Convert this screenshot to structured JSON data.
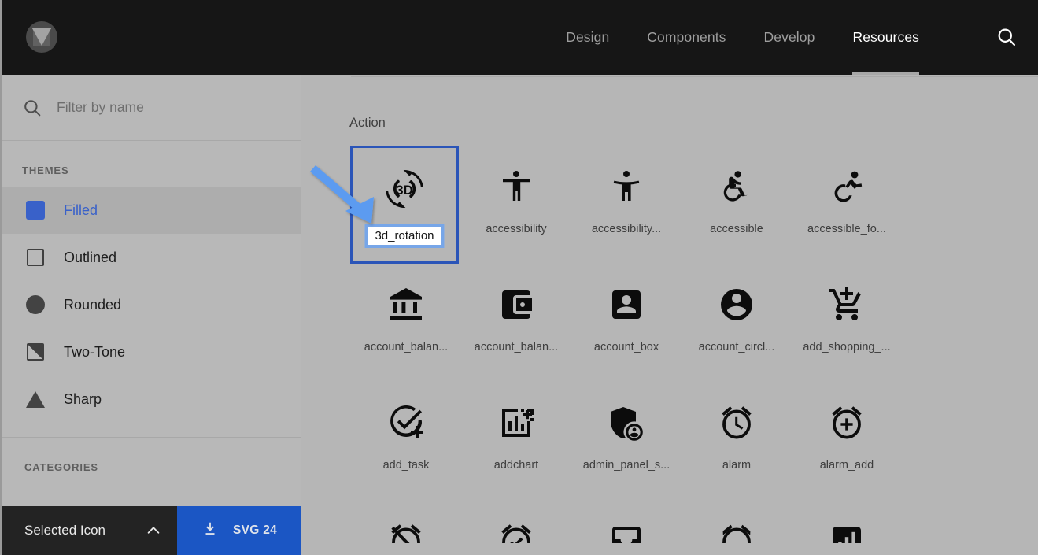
{
  "header": {
    "logo_name": "material-design-logo",
    "nav": [
      {
        "label": "Design",
        "active": false
      },
      {
        "label": "Components",
        "active": false
      },
      {
        "label": "Develop",
        "active": false
      },
      {
        "label": "Resources",
        "active": true
      }
    ],
    "search_icon": "search-icon"
  },
  "sidebar": {
    "filter": {
      "icon": "search-icon",
      "value": "",
      "placeholder": "Filter by name"
    },
    "themes_heading": "THEMES",
    "themes": [
      {
        "label": "Filled",
        "swatch": "filled-square-swatch",
        "selected": true
      },
      {
        "label": "Outlined",
        "swatch": "outlined-square-swatch",
        "selected": false
      },
      {
        "label": "Rounded",
        "swatch": "rounded-circle-swatch",
        "selected": false
      },
      {
        "label": "Two-Tone",
        "swatch": "two-tone-swatch",
        "selected": false
      },
      {
        "label": "Sharp",
        "swatch": "sharp-triangle-swatch",
        "selected": false
      }
    ],
    "categories_heading": "CATEGORIES"
  },
  "bottombar": {
    "selected_icon_label": "Selected Icon",
    "chevron_icon": "chevron-up-icon",
    "download_icon": "download-icon",
    "download_label": "SVG 24"
  },
  "content": {
    "group_title": "Action",
    "selected_icon_tooltip": "3d_rotation",
    "icons": [
      {
        "name": "3d_rotation",
        "glyph": "3d-rotation-icon",
        "selected": true
      },
      {
        "name": "accessibility",
        "glyph": "accessibility-icon",
        "selected": false
      },
      {
        "name": "accessibility...",
        "glyph": "accessibility-new-icon",
        "selected": false
      },
      {
        "name": "accessible",
        "glyph": "accessible-icon",
        "selected": false
      },
      {
        "name": "accessible_fo...",
        "glyph": "accessible-forward-icon",
        "selected": false
      },
      {
        "name": "account_balan...",
        "glyph": "account-balance-icon",
        "selected": false
      },
      {
        "name": "account_balan...",
        "glyph": "account-balance-wallet-icon",
        "selected": false
      },
      {
        "name": "account_box",
        "glyph": "account-box-icon",
        "selected": false
      },
      {
        "name": "account_circl...",
        "glyph": "account-circle-icon",
        "selected": false
      },
      {
        "name": "add_shopping_...",
        "glyph": "add-shopping-cart-icon",
        "selected": false
      },
      {
        "name": "add_task",
        "glyph": "add-task-icon",
        "selected": false
      },
      {
        "name": "addchart",
        "glyph": "addchart-icon",
        "selected": false
      },
      {
        "name": "admin_panel_s...",
        "glyph": "admin-panel-settings-icon",
        "selected": false
      },
      {
        "name": "alarm",
        "glyph": "alarm-icon",
        "selected": false
      },
      {
        "name": "alarm_add",
        "glyph": "alarm-add-icon",
        "selected": false
      }
    ],
    "partial_row_icons": [
      {
        "glyph": "alarm-off-icon"
      },
      {
        "glyph": "alarm-on-icon"
      },
      {
        "glyph": "all-inbox-icon"
      },
      {
        "glyph": "timer-icon"
      },
      {
        "glyph": "analytics-icon"
      }
    ],
    "annotation": {
      "type": "arrow",
      "color": "#5b9bf0",
      "points_to": "3d_rotation"
    }
  },
  "colors": {
    "accent_blue": "#1b56c4",
    "selection_border": "#2b55b8",
    "annotation_blue": "#5b9bf0",
    "header_bg": "#161616",
    "page_bg": "#b6b6b6"
  }
}
